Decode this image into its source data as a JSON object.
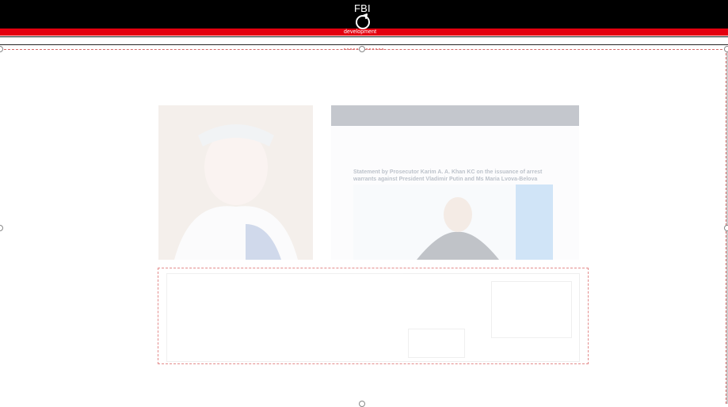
{
  "header": {
    "brand": "FBI",
    "tagline": "development"
  },
  "images": [
    {
      "name": "queen-photo",
      "kind": "photo"
    },
    {
      "name": "icc-screenshot",
      "kind": "screenshot",
      "visible_text": "Statement by Prosecutor Karim A. A. Khan KC on the issuance of arrest warrants against President Vladimir Putin and Ms Maria Lvova-Belova"
    }
  ],
  "colors": {
    "header_bg": "#000000",
    "accent_red": "#e3000f",
    "selection_dash": "#e48c8c"
  },
  "icons": {
    "rotate": "rotate-handle-icon"
  }
}
